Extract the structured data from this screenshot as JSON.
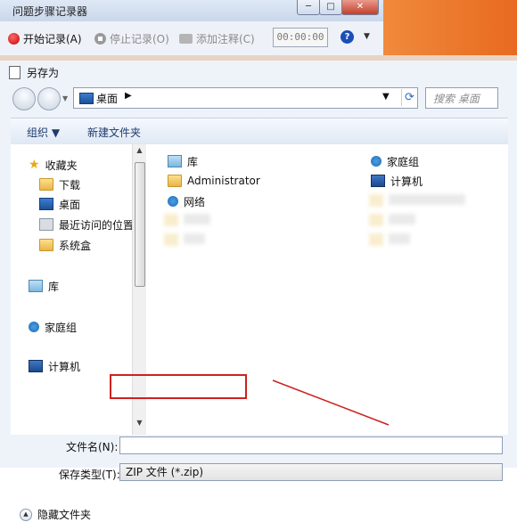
{
  "psr": {
    "title": "问题步骤记录器",
    "start_record": "开始记录(A)",
    "stop_record": "停止记录(O)",
    "add_comment": "添加注释(C)",
    "timer": "00:00:00",
    "help": "?"
  },
  "dialog": {
    "title": "另存为",
    "address": "桌面",
    "search_placeholder": "搜索 桌面",
    "organize": "组织 ▼",
    "new_folder": "新建文件夹",
    "nav": {
      "favorites": "收藏夹",
      "downloads": "下载",
      "desktop": "桌面",
      "recent": "最近访问的位置",
      "system_box": "系统盒",
      "libraries": "库",
      "homegroup": "家庭组",
      "computer": "计算机"
    },
    "files": {
      "libraries": "库",
      "administrator": "Administrator",
      "network": "网络",
      "homegroup": "家庭组",
      "computer": "计算机"
    },
    "file_name_label": "文件名(N):",
    "file_name_value": "",
    "save_type_label": "保存类型(T):",
    "save_type_value": "ZIP 文件 (*.zip)",
    "hide_folders": "隐藏文件夹"
  },
  "colors": {
    "highlight_box": "#d02020",
    "accent_orange": "#e87a30"
  }
}
